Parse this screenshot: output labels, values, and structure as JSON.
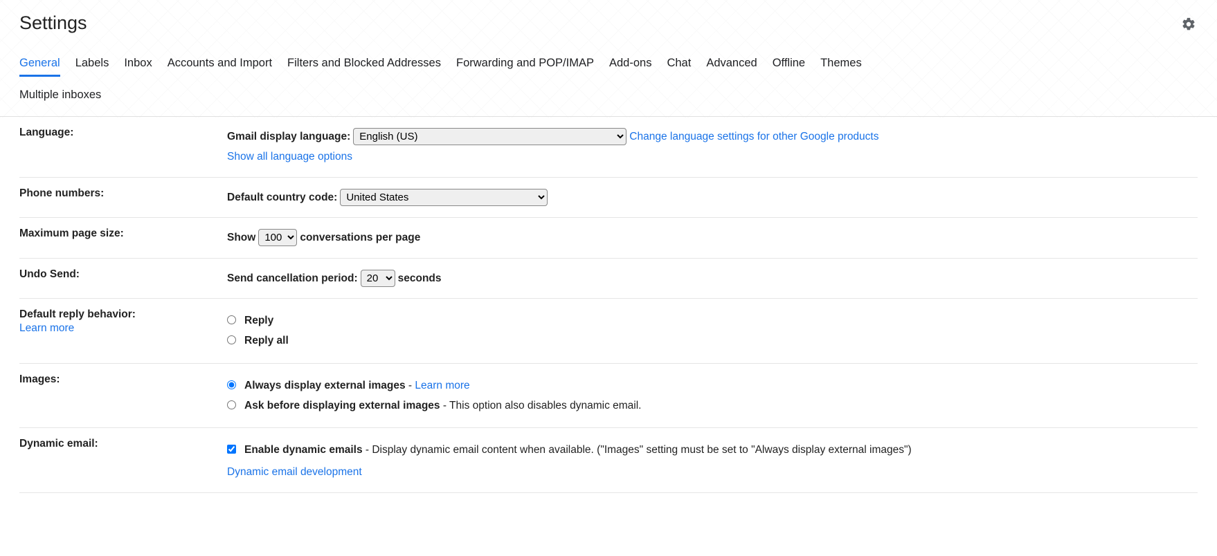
{
  "page_title": "Settings",
  "tabs": [
    {
      "label": "General",
      "active": true
    },
    {
      "label": "Labels"
    },
    {
      "label": "Inbox"
    },
    {
      "label": "Accounts and Import"
    },
    {
      "label": "Filters and Blocked Addresses"
    },
    {
      "label": "Forwarding and POP/IMAP"
    },
    {
      "label": "Add-ons"
    },
    {
      "label": "Chat"
    },
    {
      "label": "Advanced"
    },
    {
      "label": "Offline"
    },
    {
      "label": "Themes"
    }
  ],
  "tabs_row2": [
    {
      "label": "Multiple inboxes"
    }
  ],
  "language": {
    "label": "Language:",
    "display_label": "Gmail display language:",
    "selected": "English (US)",
    "other_link": "Change language settings for other Google products",
    "show_all": "Show all language options"
  },
  "phone": {
    "label": "Phone numbers:",
    "code_label": "Default country code:",
    "selected": "United States"
  },
  "page_size": {
    "label": "Maximum page size:",
    "prefix": "Show",
    "selected": "100",
    "suffix": "conversations per page"
  },
  "undo": {
    "label": "Undo Send:",
    "prefix": "Send cancellation period:",
    "selected": "20",
    "suffix": "seconds"
  },
  "reply": {
    "label": "Default reply behavior:",
    "learn_more": "Learn more",
    "opt1": "Reply",
    "opt2": "Reply all"
  },
  "images": {
    "label": "Images:",
    "opt1": "Always display external images",
    "sep": " - ",
    "learn_more": "Learn more",
    "opt2": "Ask before displaying external images",
    "opt2_desc": " - This option also disables dynamic email."
  },
  "dynamic": {
    "label": "Dynamic email:",
    "check_label": "Enable dynamic emails",
    "desc": " - Display dynamic email content when available. (\"Images\" setting must be set to \"Always display external images\")",
    "dev_link": "Dynamic email development"
  }
}
